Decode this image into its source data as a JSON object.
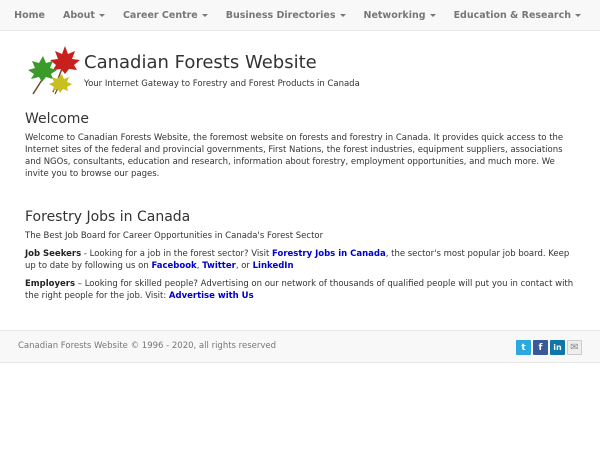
{
  "nav": {
    "items": [
      {
        "label": "Home",
        "dropdown": false
      },
      {
        "label": "About",
        "dropdown": true
      },
      {
        "label": "Career Centre",
        "dropdown": true
      },
      {
        "label": "Business Directories",
        "dropdown": true
      },
      {
        "label": "Networking",
        "dropdown": true
      },
      {
        "label": "Education & Research",
        "dropdown": true
      }
    ]
  },
  "header": {
    "title": "Canadian Forests Website",
    "tagline": "Your Internet Gateway to Forestry and Forest Products in Canada"
  },
  "welcome": {
    "heading": "Welcome",
    "text": "Welcome to Canadian Forests Website, the foremost website on forests and forestry in Canada. It provides quick access to the Internet sites of the federal and provincial governments, First Nations, the forest industries, equipment suppliers, associations and NGOs, consultants, education and research, information about forestry, employment opportunities, and much more. We invite you to browse our pages."
  },
  "jobs": {
    "heading": "Forestry Jobs in Canada",
    "subheading": "The Best Job Board for Career Opportunities in Canada's Forest Sector",
    "seekers": {
      "label": "Job Seekers",
      "text1": " - Looking for a job in the forest sector? Visit ",
      "link_jobs": "Forestry Jobs in Canada",
      "text2": ", the sector's most popular job board. Keep up to date by following us on ",
      "link_facebook": "Facebook",
      "sep1": ", ",
      "link_twitter": "Twitter",
      "sep2": ", or ",
      "link_linkedin": "LinkedIn"
    },
    "employers": {
      "label": "Employers",
      "text1": " – Looking for skilled people? Advertising on our network of thousands of qualified people will put you in contact with the right people for the job. Visit: ",
      "link_advertise": "Advertise with Us"
    }
  },
  "footer": {
    "copyright": "Canadian Forests Website © 1996 - 2020, all rights reserved",
    "social": [
      {
        "icon": "twitter-icon",
        "glyph": "t",
        "color": "#2aa9e0"
      },
      {
        "icon": "facebook-icon",
        "glyph": "f",
        "color": "#3b5998"
      },
      {
        "icon": "linkedin-icon",
        "glyph": "in",
        "color": "#0e76a8"
      },
      {
        "icon": "email-icon",
        "glyph": "✉",
        "color": "#888888"
      }
    ]
  },
  "colors": {
    "link": "#0000cc",
    "leaf_red": "#c8201c",
    "leaf_green": "#3a9a2a",
    "leaf_yellow": "#c8c020"
  }
}
